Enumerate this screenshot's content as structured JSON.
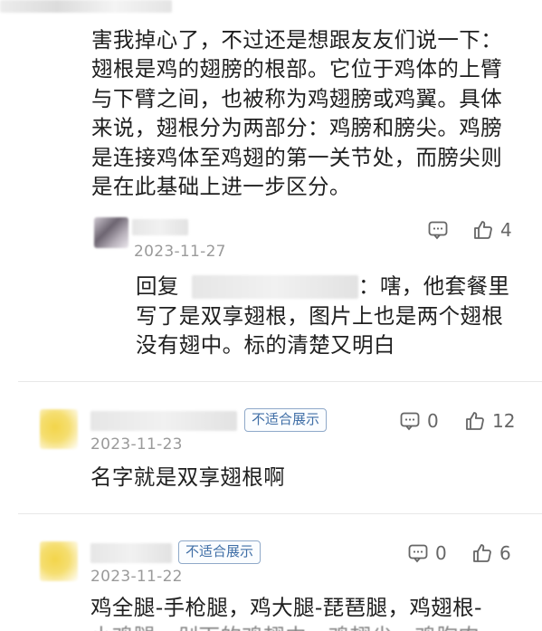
{
  "comment1": {
    "text_lines": [
      "害我掉心了，不过还是想跟友友们说一下：",
      "翅根是鸡的翅膀的根部。它位于鸡体的上臂",
      "与下臂之间，也被称为鸡翅膀或鸡翼。具体",
      "来说，翅根分为两部分：鸡膀和膀尖。鸡膀",
      "是连接鸡体至鸡翅的第一关节处，而膀尖则",
      "是在此基础上进一步区分。"
    ]
  },
  "reply1": {
    "date": "2023-11-27",
    "comment_icon": "comment-icon",
    "like_icon": "thumbs-up-icon",
    "like_count": "4",
    "reply_prefix": "回复",
    "reply_lines": [
      "：嗐，他套餐里",
      "写了是双享翅根，图片上也是两个翅根",
      "没有翅中。标的清楚又明白"
    ]
  },
  "comment2": {
    "badge": "不适合展示",
    "date": "2023-11-23",
    "comment_count": "0",
    "like_count": "12",
    "text": "名字就是双享翅根啊"
  },
  "comment3": {
    "badge": "不适合展示",
    "date": "2023-11-22",
    "comment_count": "0",
    "like_count": "6",
    "text_lines": [
      "鸡全腿-手枪腿，鸡大腿-琵琶腿，鸡翅根-",
      "小鸡腿，剁下的鸡翅中，鸡翅尖，鸡胸肉"
    ]
  },
  "colors": {
    "badge_border": "#8fa9c9",
    "badge_text": "#3f6ea6",
    "date_text": "#9a9a9a",
    "avatar_yellow": "#f3d54a"
  }
}
